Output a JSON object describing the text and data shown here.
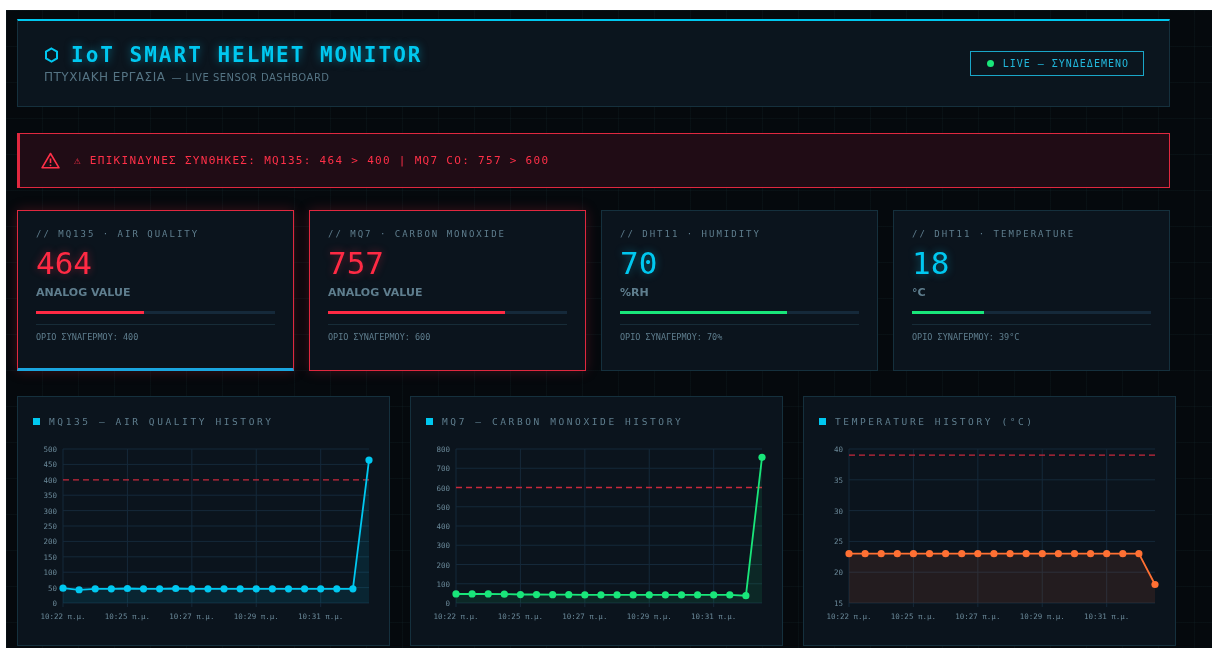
{
  "header": {
    "title": "IoT SMART HELMET MONITOR",
    "subtitle": "ΠΤΥΧΙΑΚΗ ΕΡΓΑΣΙΑ",
    "subtitle_suffix": "— LIVE SENSOR DASHBOARD",
    "status": {
      "label": "LIVE — ΣΥΝΔΕΔΕΜΕΝΟ",
      "online": true
    }
  },
  "alert": {
    "text": "⚠ ΕΠΙΚΙΝΔΥΝΕΣ ΣΥΝΘΗΚΕΣ: MQ135: 464 > 400 | MQ7 CO: 757 > 600"
  },
  "cards": [
    {
      "label": "// MQ135 · AIR QUALITY",
      "value": "464",
      "unit": "ANALOG VALUE",
      "level": 0.45,
      "alarm": true,
      "selected": true,
      "threshold": "ΟΡΙΟ ΣΥΝΑΓΕΡΜΟΥ: 400"
    },
    {
      "label": "// MQ7 · CARBON MONOXIDE",
      "value": "757",
      "unit": "ANALOG VALUE",
      "level": 0.74,
      "alarm": true,
      "selected": false,
      "threshold": "ΟΡΙΟ ΣΥΝΑΓΕΡΜΟΥ: 600"
    },
    {
      "label": "// DHT11 · HUMIDITY",
      "value": "70",
      "unit": "%RH",
      "level": 0.7,
      "alarm": false,
      "selected": false,
      "threshold": "ΟΡΙΟ ΣΥΝΑΓΕΡΜΟΥ: 70%"
    },
    {
      "label": "// DHT11 · TEMPERATURE",
      "value": "18",
      "unit": "°C",
      "level": 0.3,
      "alarm": false,
      "selected": false,
      "threshold": "ΟΡΙΟ ΣΥΝΑΓΕΡΜΟΥ: 39°C"
    }
  ],
  "charts": [
    {
      "title": "MQ135 — AIR QUALITY HISTORY",
      "chart_data": {
        "type": "area",
        "categories": [
          "10:22 π.μ.",
          null,
          null,
          null,
          "10:25 π.μ.",
          null,
          null,
          null,
          "10:27 π.μ.",
          null,
          null,
          null,
          "10:29 π.μ.",
          null,
          null,
          null,
          "10:31 π.μ.",
          null,
          null,
          null
        ],
        "ylim": [
          0,
          500
        ],
        "yticks": [
          0,
          50,
          100,
          150,
          200,
          250,
          300,
          350,
          400,
          450,
          500
        ],
        "series": [
          {
            "color": "#00c8f0",
            "values": [
              48,
              43,
              46,
              46,
              47,
              46,
              46,
              47,
              46,
              46,
              46,
              46,
              46,
              46,
              46,
              46,
              46,
              46,
              46,
              464
            ]
          }
        ],
        "ref_lines": [
          {
            "axis": "y",
            "value": 400
          }
        ],
        "grid": true
      }
    },
    {
      "title": "MQ7 — CARBON MONOXIDE HISTORY",
      "chart_data": {
        "type": "area",
        "categories": [
          "10:22 π.μ.",
          null,
          null,
          null,
          "10:25 π.μ.",
          null,
          null,
          null,
          "10:27 π.μ.",
          null,
          null,
          null,
          "10:29 π.μ.",
          null,
          null,
          null,
          "10:31 π.μ.",
          null,
          null,
          null
        ],
        "ylim": [
          0,
          800
        ],
        "yticks": [
          0,
          100,
          200,
          300,
          400,
          500,
          600,
          700,
          800
        ],
        "series": [
          {
            "color": "#19e67a",
            "values": [
              47,
              47,
              47,
              46,
              44,
              44,
              43,
              43,
              42,
              42,
              42,
              42,
              42,
              42,
              42,
              42,
              42,
              42,
              38,
              757
            ]
          }
        ],
        "ref_lines": [
          {
            "axis": "y",
            "value": 600
          }
        ],
        "grid": true
      }
    },
    {
      "title": "TEMPERATURE HISTORY (°C)",
      "chart_data": {
        "type": "area",
        "categories": [
          "10:22 π.μ.",
          null,
          null,
          null,
          "10:25 π.μ.",
          null,
          null,
          null,
          "10:27 π.μ.",
          null,
          null,
          null,
          "10:29 π.μ.",
          null,
          null,
          null,
          "10:31 π.μ.",
          null,
          null,
          null
        ],
        "ylim": [
          15,
          40
        ],
        "yticks": [
          15,
          20,
          25,
          30,
          35,
          40
        ],
        "series": [
          {
            "color": "#ff7033",
            "values": [
              23,
              23,
              23,
              23,
              23,
              23,
              23,
              23,
              23,
              23,
              23,
              23,
              23,
              23,
              23,
              23,
              23,
              23,
              23,
              18
            ]
          }
        ],
        "ref_lines": [
          {
            "axis": "y",
            "value": 39
          }
        ],
        "grid": true
      }
    }
  ]
}
